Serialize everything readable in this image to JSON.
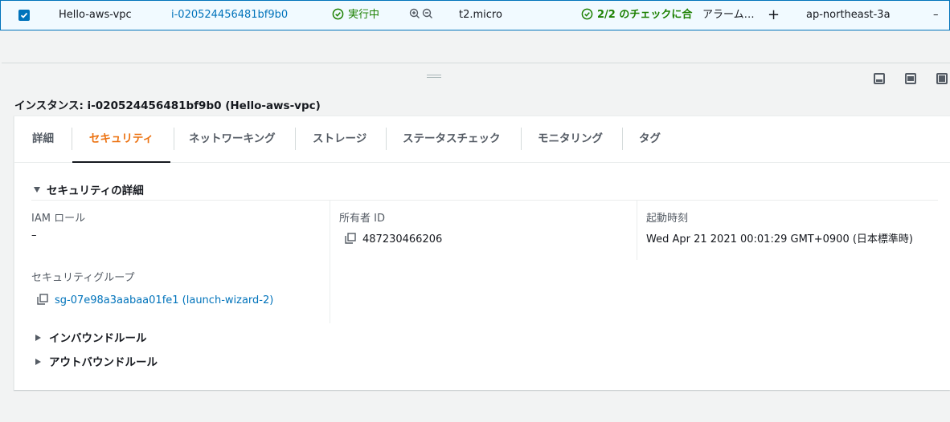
{
  "instance_row": {
    "name": "Hello-aws-vpc",
    "instance_id": "i-020524456481bf9b0",
    "state": "実行中",
    "instance_type": "t2.micro",
    "status_check": "2/2 のチェックに合",
    "alarm": "アラーム…",
    "add_alarm": "+",
    "az": "ap-northeast-3a",
    "overflow": "–"
  },
  "detail_panel": {
    "title": "インスタンス: i-020524456481bf9b0 (Hello-aws-vpc)"
  },
  "tabs": [
    {
      "label": "詳細"
    },
    {
      "label": "セキュリティ"
    },
    {
      "label": "ネットワーキング"
    },
    {
      "label": "ストレージ"
    },
    {
      "label": "ステータスチェック"
    },
    {
      "label": "モニタリング"
    },
    {
      "label": "タグ"
    }
  ],
  "active_tab": "セキュリティ",
  "security": {
    "section_title": "セキュリティの詳細",
    "iam_role_label": "IAM ロール",
    "iam_role_value": "–",
    "owner_label": "所有者 ID",
    "owner_value": "487230466206",
    "launch_time_label": "起動時刻",
    "launch_time_value": "Wed Apr 21 2021 00:01:29 GMT+0900 (日本標準時)",
    "sg_label": "セキュリティグループ",
    "sg_value": "sg-07e98a3aabaa01fe1 (launch-wizard-2)",
    "inbound_rules": "インバウンドルール",
    "outbound_rules": "アウトバウンドルール"
  },
  "colors": {
    "link": "#0073bb",
    "success": "#1d8102",
    "active_tab": "#ec7211",
    "selected_row_bg": "#f1faff"
  },
  "icons": [
    "checkbox-checked-icon",
    "status-check-circle-icon",
    "zoom-in-icon",
    "zoom-out-icon",
    "plus-icon",
    "drag-handle-icon",
    "panel-bottom-icon",
    "panel-split-icon",
    "panel-full-icon",
    "triangle-down-icon",
    "triangle-right-icon",
    "copy-icon"
  ]
}
